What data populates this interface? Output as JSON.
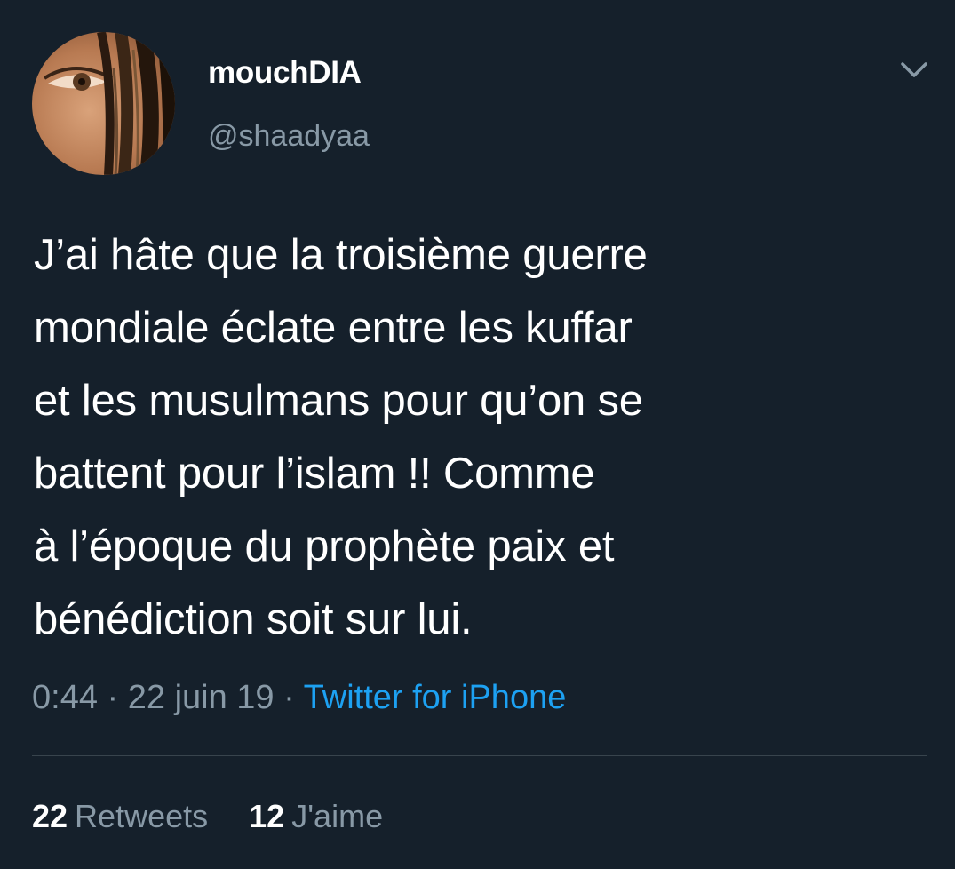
{
  "tweet": {
    "display_name": "mouchDIA",
    "handle": "@shaadyaa",
    "text": "J’ai hâte que la troisième guerre\nmondiale éclate entre les kuffar\net les musulmans pour qu’on se\nbattent pour l’islam !! Comme\nà l’époque du prophète paix et\nbénédiction soit sur lui.",
    "time": "0:44",
    "separator": " · ",
    "date": "22 juin 19",
    "source": "Twitter for iPhone",
    "retweets_count": "22",
    "retweets_label": "Retweets",
    "likes_count": "12",
    "likes_label": "J'aime"
  },
  "icons": {
    "menu": "chevron-down-icon"
  },
  "colors": {
    "background": "#15202b",
    "text_primary": "#ffffff",
    "text_secondary": "#8899a6",
    "link": "#1da1f2",
    "divider": "#38444d"
  }
}
